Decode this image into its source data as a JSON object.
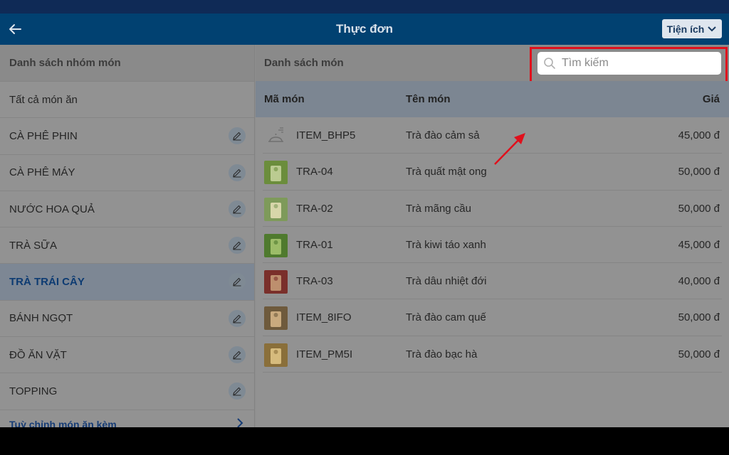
{
  "header": {
    "title": "Thực đơn",
    "utilities_label": "Tiện ích"
  },
  "sidebar": {
    "heading": "Danh sách nhóm món",
    "all_items": "Tất cả món ăn",
    "groups": [
      {
        "label": "CÀ PHÊ PHIN"
      },
      {
        "label": "CÀ PHÊ MÁY"
      },
      {
        "label": "NƯỚC HOA QUẢ"
      },
      {
        "label": "TRÀ SỮA"
      },
      {
        "label": "TRÀ TRÁI CÂY",
        "active": true
      },
      {
        "label": "BÁNH NGỌT"
      },
      {
        "label": "ĐỒ ĂN VẶT"
      },
      {
        "label": "TOPPING"
      }
    ],
    "customize_link": "Tuỳ chỉnh món ăn kèm"
  },
  "main": {
    "heading": "Danh sách món",
    "search": {
      "placeholder": "Tìm kiếm",
      "value": ""
    },
    "columns": {
      "code": "Mã món",
      "name": "Tên món",
      "price": "Giá"
    },
    "rows": [
      {
        "code": "ITEM_BHP5",
        "name": "Trà đào cảm sả",
        "price": "45,000 đ",
        "thumb": "placeholder"
      },
      {
        "code": "TRA-04",
        "name": "Trà quất mật ong",
        "price": "50,000 đ",
        "thumb": "photo"
      },
      {
        "code": "TRA-02",
        "name": "Trà mãng cầu",
        "price": "50,000 đ",
        "thumb": "photo"
      },
      {
        "code": "TRA-01",
        "name": "Trà kiwi táo xanh",
        "price": "45,000 đ",
        "thumb": "photo"
      },
      {
        "code": "TRA-03",
        "name": "Trà dâu nhiệt đới",
        "price": "40,000 đ",
        "thumb": "photo"
      },
      {
        "code": "ITEM_8IFO",
        "name": "Trà đào cam quế",
        "price": "50,000 đ",
        "thumb": "photo"
      },
      {
        "code": "ITEM_PM5I",
        "name": "Trà đào bạc hà",
        "price": "50,000 đ",
        "thumb": "photo"
      }
    ]
  },
  "colors": {
    "header_bg": "#014171",
    "highlight": "#e0101c",
    "overlay": "#929292"
  }
}
